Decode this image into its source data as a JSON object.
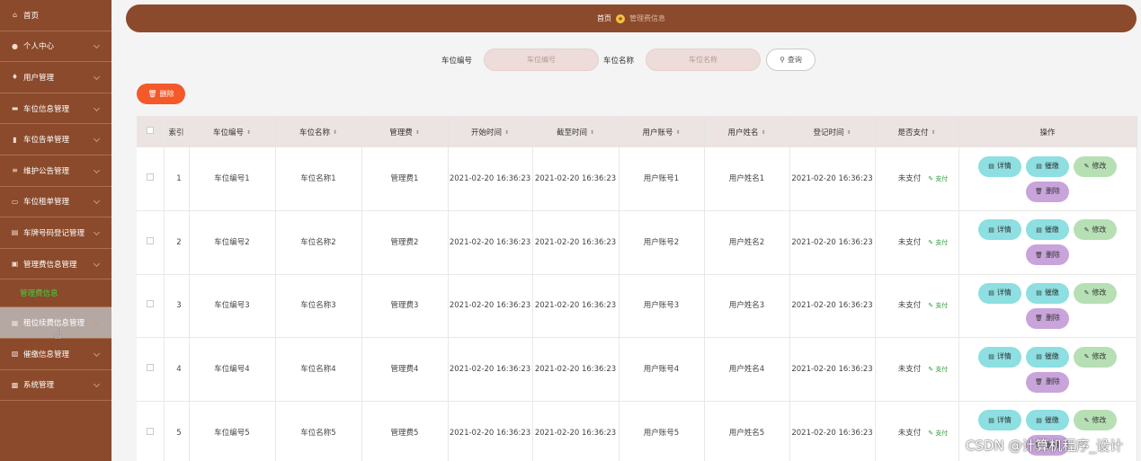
{
  "sidebar": {
    "items": [
      {
        "label": "首页",
        "icon": "home-icon",
        "chev": false
      },
      {
        "label": "个人中心",
        "icon": "user-icon",
        "chev": true
      },
      {
        "label": "用户管理",
        "icon": "users-icon",
        "chev": true
      },
      {
        "label": "车位信息管理",
        "icon": "car-icon",
        "chev": true
      },
      {
        "label": "车位告单管理",
        "icon": "ticket-icon",
        "chev": true
      },
      {
        "label": "维护公告管理",
        "icon": "announce-icon",
        "chev": true
      },
      {
        "label": "车位租单管理",
        "icon": "lease-icon",
        "chev": true
      },
      {
        "label": "车牌号码登记管理",
        "icon": "plate-icon",
        "chev": true
      },
      {
        "label": "管理费信息管理",
        "icon": "fee-icon",
        "chev": true
      }
    ],
    "submenu_label": "管理费信息",
    "items_after": [
      {
        "label": "租位续费信息管理",
        "icon": "renew-icon",
        "chev": true
      },
      {
        "label": "催缴信息管理",
        "icon": "urge-icon",
        "chev": true
      },
      {
        "label": "系统管理",
        "icon": "settings-icon",
        "chev": true
      }
    ]
  },
  "breadcrumb": {
    "home": "首页",
    "current": "管理费信息"
  },
  "search": {
    "label1": "车位编号",
    "placeholder1": "车位编号",
    "label2": "车位名称",
    "placeholder2": "车位名称",
    "button": "查询"
  },
  "toolbar": {
    "delete_label": "删除"
  },
  "table": {
    "headers": [
      "索引",
      "车位编号",
      "车位名称",
      "管理费",
      "开始时间",
      "截至时间",
      "用户账号",
      "用户姓名",
      "登记时间",
      "是否支付",
      "操作"
    ],
    "rows": [
      {
        "index": "1",
        "code": "车位编号1",
        "name": "车位名称1",
        "fee": "管理费1",
        "start": "2021-02-20 16:36:23",
        "end": "2021-02-20 16:36:23",
        "account": "用户账号1",
        "user": "用户姓名1",
        "reg": "2021-02-20 16:36:23",
        "paid": "未支付",
        "pay_link": "支付"
      },
      {
        "index": "2",
        "code": "车位编号2",
        "name": "车位名称2",
        "fee": "管理费2",
        "start": "2021-02-20 16:36:23",
        "end": "2021-02-20 16:36:23",
        "account": "用户账号2",
        "user": "用户姓名2",
        "reg": "2021-02-20 16:36:23",
        "paid": "未支付",
        "pay_link": "支付"
      },
      {
        "index": "3",
        "code": "车位编号3",
        "name": "车位名称3",
        "fee": "管理费3",
        "start": "2021-02-20 16:36:23",
        "end": "2021-02-20 16:36:23",
        "account": "用户账号3",
        "user": "用户姓名3",
        "reg": "2021-02-20 16:36:23",
        "paid": "未支付",
        "pay_link": "支付"
      },
      {
        "index": "4",
        "code": "车位编号4",
        "name": "车位名称4",
        "fee": "管理费4",
        "start": "2021-02-20 16:36:23",
        "end": "2021-02-20 16:36:23",
        "account": "用户账号4",
        "user": "用户姓名4",
        "reg": "2021-02-20 16:36:23",
        "paid": "未支付",
        "pay_link": "支付"
      },
      {
        "index": "5",
        "code": "车位编号5",
        "name": "车位名称5",
        "fee": "管理费5",
        "start": "2021-02-20 16:36:23",
        "end": "2021-02-20 16:36:23",
        "account": "用户账号5",
        "user": "用户姓名5",
        "reg": "2021-02-20 16:36:23",
        "paid": "未支付",
        "pay_link": "支付"
      }
    ],
    "ops": {
      "detail": "详情",
      "urge": "催缴",
      "edit": "修改",
      "delete": "删除"
    }
  },
  "watermark": "CSDN @计算机程序_设计",
  "colors": {
    "brand": "#8b4a2b",
    "danger": "#f4592a",
    "active_submenu": "#3fd13f"
  }
}
